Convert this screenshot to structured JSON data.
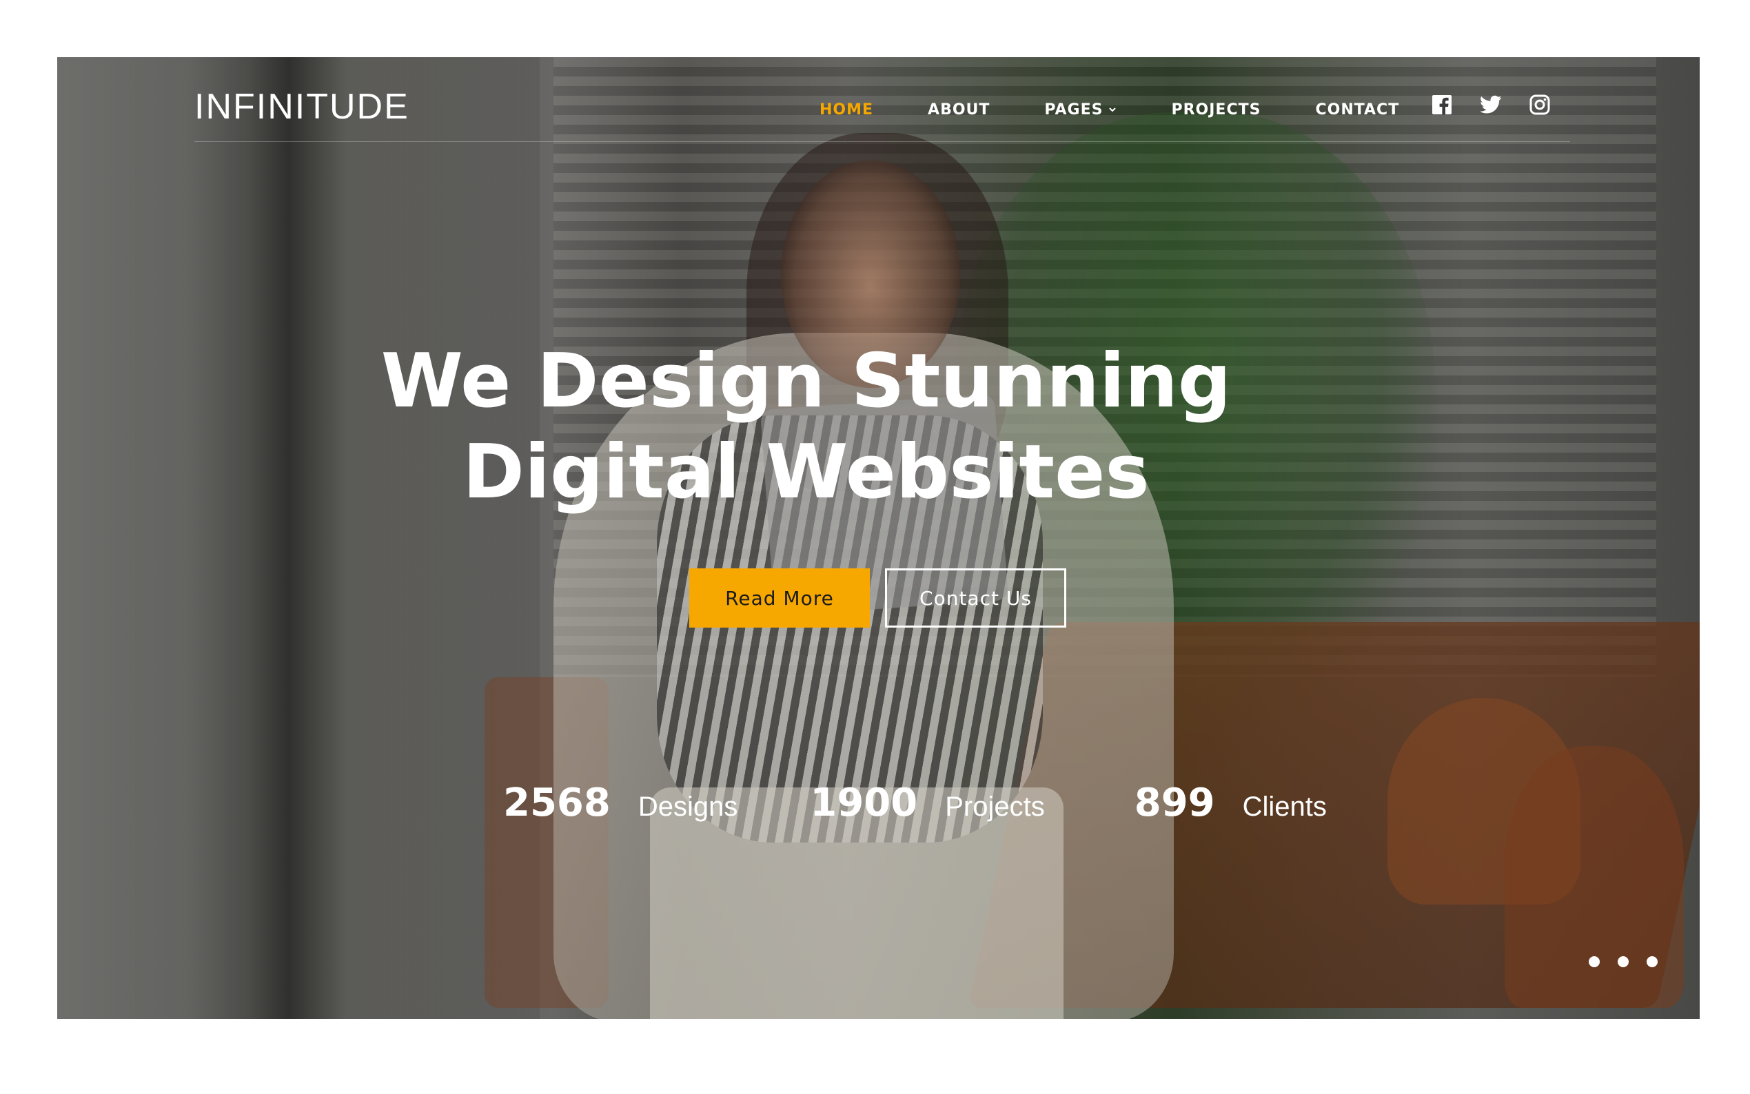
{
  "brand": {
    "logo": "INFINITUDE"
  },
  "nav": {
    "items": [
      {
        "label": "HOME",
        "active": true
      },
      {
        "label": "ABOUT",
        "active": false
      },
      {
        "label": "PAGES",
        "active": false,
        "has_dropdown": true
      },
      {
        "label": "PROJECTS",
        "active": false
      },
      {
        "label": "CONTACT",
        "active": false
      }
    ],
    "social": [
      "facebook-icon",
      "twitter-icon",
      "instagram-icon"
    ]
  },
  "hero": {
    "headline_line1": "We Design Stunning",
    "headline_line2": "Digital Websites",
    "primary_button": "Read More",
    "secondary_button": "Contact Us",
    "stats": [
      {
        "number": "2568",
        "label": "Designs"
      },
      {
        "number": "1900",
        "label": "Projects"
      },
      {
        "number": "899",
        "label": "Clients"
      }
    ],
    "slider_dots": 3
  },
  "colors": {
    "accent": "#f6a800",
    "text": "#ffffff",
    "page_background": "#ffffff"
  }
}
